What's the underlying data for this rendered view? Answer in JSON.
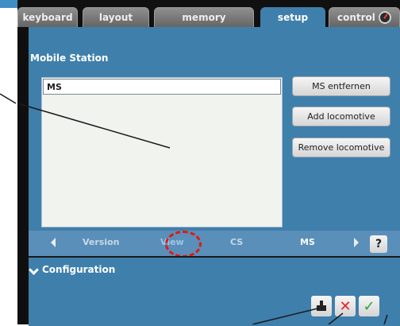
{
  "tabs": [
    {
      "label": "keyboard",
      "active": false
    },
    {
      "label": "layout",
      "active": false
    },
    {
      "label": "memory",
      "active": false
    },
    {
      "label": "setup",
      "active": true
    },
    {
      "label": "control",
      "active": false
    }
  ],
  "main": {
    "section_title": "Mobile Station",
    "list_items": [
      "MS"
    ],
    "buttons": [
      "MS entfernen",
      "Add locomotive",
      "Remove locomotive"
    ]
  },
  "subnav": {
    "items": [
      "Version",
      "View",
      "CS",
      "MS"
    ],
    "active": "View",
    "help_label": "?"
  },
  "config": {
    "title": "Configuration",
    "actions": [
      "save-icon",
      "cancel-icon",
      "confirm-icon"
    ]
  },
  "colors": {
    "panel": "#3f7fac",
    "tab_inactive": "#7a7a7a",
    "highlight": "#e01818",
    "cancel": "#e52222",
    "confirm": "#21a83c"
  }
}
